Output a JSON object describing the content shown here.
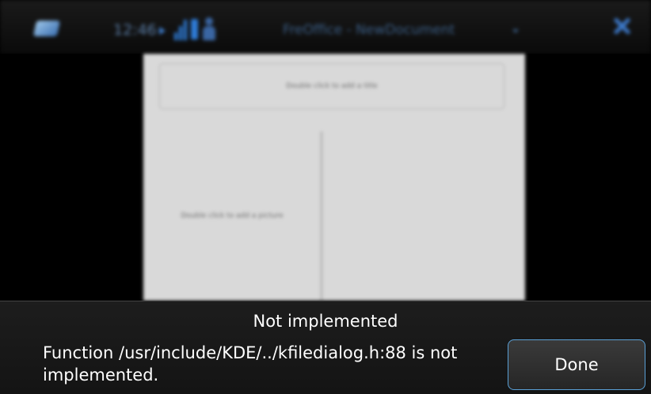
{
  "statusbar": {
    "time": "12:46",
    "window_title": "FreOffice - NewDocument",
    "icons": [
      "app-switcher-icon",
      "play-icon",
      "signal-icon",
      "battery-icon",
      "user-icon",
      "menu-arrow-icon",
      "close-icon"
    ]
  },
  "document": {
    "title_placeholder": "Double click to add a title",
    "picture_placeholder": "Double click to add a picture"
  },
  "banner": {
    "title": "Not implemented",
    "message": "Function /usr/include/KDE/../kfiledialog.h:88 is not implemented.",
    "done_label": "Done"
  },
  "colors": {
    "accent": "#5aa0d6",
    "banner_bg": "#1a1a1a",
    "page_bg": "#d9d9d9"
  }
}
